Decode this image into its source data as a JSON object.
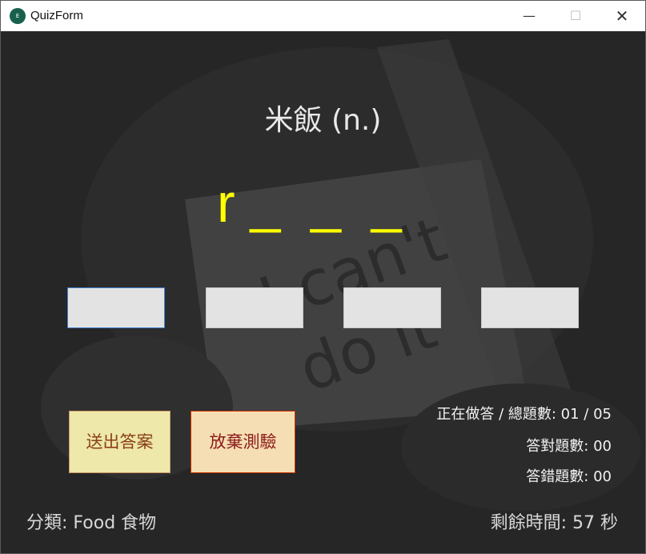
{
  "window": {
    "title": "QuizForm",
    "icon_text": "E",
    "minimize_glyph": "—",
    "maximize_glyph": "☐",
    "close_glyph": "✕"
  },
  "background": {
    "note_lines": [
      "I can't",
      "do it"
    ]
  },
  "quiz": {
    "word": "米飯  (n.)",
    "hint": "r _  _  _",
    "answer_boxes": [
      "",
      "",
      "",
      ""
    ],
    "submit_label": "送出答案",
    "giveup_label": "放棄測驗"
  },
  "stats": {
    "progress": "正在做答 / 總題數: 01 / 05",
    "correct": "答對題數: 00",
    "wrong": "答錯題數: 00"
  },
  "footer": {
    "category": "分類: Food 食物",
    "time_left": "剩餘時間: 57 秒"
  },
  "colors": {
    "hint": "#ffff00",
    "submit_bg": "#eee8aa",
    "giveup_bg": "#f5deb3",
    "background": "#262626"
  }
}
